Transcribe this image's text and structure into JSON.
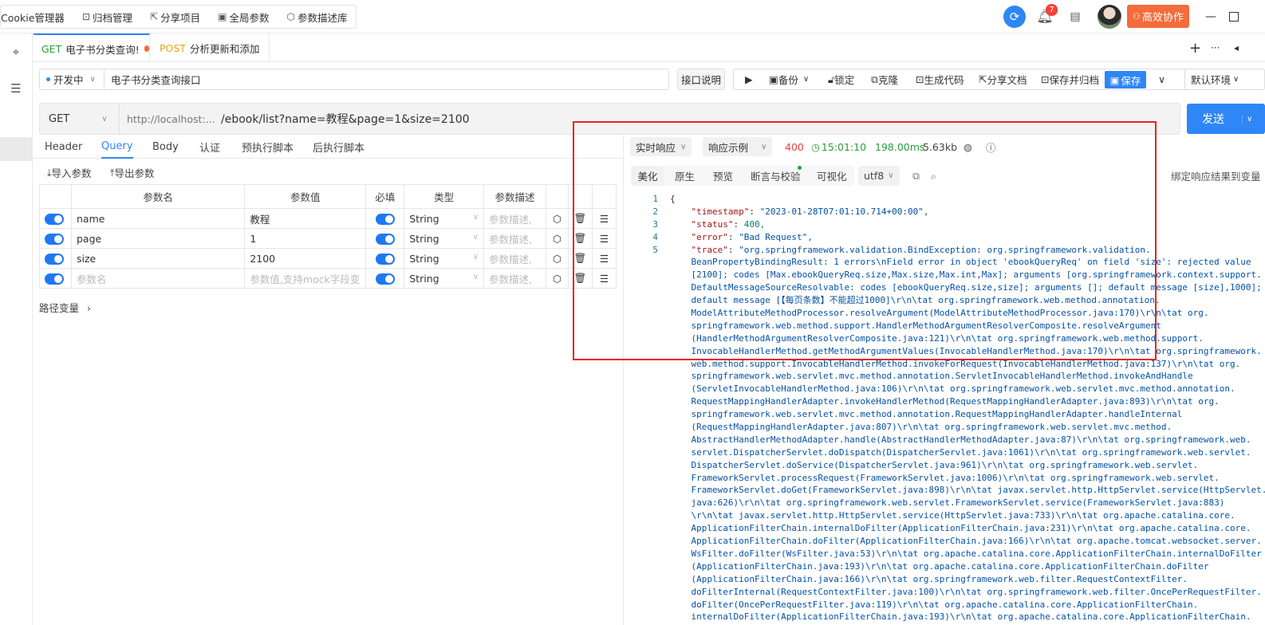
{
  "topnav": {
    "items": [
      {
        "icon": "cookie-icon",
        "label": "Cookie管理器"
      },
      {
        "icon": "archive-icon",
        "label": "归档管理"
      },
      {
        "icon": "share-icon",
        "label": "分享项目"
      },
      {
        "icon": "params-icon",
        "label": "全局参数"
      },
      {
        "icon": "cube-icon",
        "label": "参数描述库"
      }
    ],
    "notifications_count": "7",
    "collab_label": "高效协作"
  },
  "tabs": [
    {
      "method": "GET",
      "label": "电子书分类查询!",
      "unsaved": true
    },
    {
      "method": "POST",
      "label": "分析更新和添加"
    }
  ],
  "tabs_actions": {
    "add": "+",
    "more": "···",
    "collapse": "◂"
  },
  "api": {
    "status": "开发中",
    "name": "电子书分类查询接口"
  },
  "toolbar": {
    "doc_button": "接口说明",
    "backup": "备份",
    "lock": "锁定",
    "clone": "克隆",
    "gen_code": "生成代码",
    "share_doc": "分享文档",
    "save_archive": "保存并归档",
    "save": "保存",
    "env": "默认环境"
  },
  "request": {
    "method": "GET",
    "host": "http://localhost:...",
    "path": "/ebook/list?name=教程&page=1&size=2100",
    "send_label": "发送"
  },
  "req_tabs": [
    "Header",
    "Query",
    "Body",
    "认证",
    "预执行脚本",
    "后执行脚本"
  ],
  "params": {
    "import_label": "导入参数",
    "export_label": "导出参数",
    "columns": [
      "参数名",
      "参数值",
      "必填",
      "类型",
      "参数描述"
    ],
    "rows": [
      {
        "name": "name",
        "value": "教程",
        "type": "String",
        "desc": "参数描述,"
      },
      {
        "name": "page",
        "value": "1",
        "type": "String",
        "desc": "参数描述,"
      },
      {
        "name": "size",
        "value": "2100",
        "type": "String",
        "desc": "参数描述,"
      },
      {
        "name": "参数名",
        "value": "参数值,支持mock字段变",
        "type": "String",
        "desc": "参数描述,",
        "placeholder": true
      }
    ],
    "path_vars": "路径变量"
  },
  "response": {
    "mode": "实时响应",
    "example": "响应示例",
    "status_code": "400",
    "time": "15:01:10",
    "duration": "198.00ms",
    "size": "5.63kb",
    "tabs": [
      "美化",
      "原生",
      "预览",
      "断言与校验",
      "可视化"
    ],
    "encoding": "utf8",
    "bind_label": "绑定响应结果到变量",
    "line_numbers": [
      "1",
      "2",
      "3",
      "4",
      "5"
    ],
    "lines": [
      "{",
      "    \"timestamp\": \"2023-01-28T07:01:10.714+00:00\",",
      "    \"status\": 400,",
      "    \"error\": \"Bad Request\",",
      "    \"trace\": \"org.springframework.validation.BindException: org.springframework.validation.",
      "    BeanPropertyBindingResult: 1 errors\\nField error in object 'ebookQueryReq' on field 'size': rejected value",
      "    [2100]; codes [Max.ebookQueryReq.size,Max.size,Max.int,Max]; arguments [org.springframework.context.support.",
      "    DefaultMessageSourceResolvable: codes [ebookQueryReq.size,size]; arguments []; default message [size],1000];",
      "    default message [【每页条数】不能超过1000]\\r\\n\\tat org.springframework.web.method.annotation.",
      "    ModelAttributeMethodProcessor.resolveArgument(ModelAttributeMethodProcessor.java:170)\\r\\n\\tat org.",
      "    springframework.web.method.support.HandlerMethodArgumentResolverComposite.resolveArgument",
      "    (HandlerMethodArgumentResolverComposite.java:121)\\r\\n\\tat org.springframework.web.method.support.",
      "    InvocableHandlerMethod.getMethodArgumentValues(InvocableHandlerMethod.java:170)\\r\\n\\tat org.springframework.",
      "    web.method.support.InvocableHandlerMethod.invokeForRequest(InvocableHandlerMethod.java:137)\\r\\n\\tat org.",
      "    springframework.web.servlet.mvc.method.annotation.ServletInvocableHandlerMethod.invokeAndHandle",
      "    (ServletInvocableHandlerMethod.java:106)\\r\\n\\tat org.springframework.web.servlet.mvc.method.annotation.",
      "    RequestMappingHandlerAdapter.invokeHandlerMethod(RequestMappingHandlerAdapter.java:893)\\r\\n\\tat org.",
      "    springframework.web.servlet.mvc.method.annotation.RequestMappingHandlerAdapter.handleInternal",
      "    (RequestMappingHandlerAdapter.java:807)\\r\\n\\tat org.springframework.web.servlet.mvc.method.",
      "    AbstractHandlerMethodAdapter.handle(AbstractHandlerMethodAdapter.java:87)\\r\\n\\tat org.springframework.web.",
      "    servlet.DispatcherServlet.doDispatch(DispatcherServlet.java:1061)\\r\\n\\tat org.springframework.web.servlet.",
      "    DispatcherServlet.doService(DispatcherServlet.java:961)\\r\\n\\tat org.springframework.web.servlet.",
      "    FrameworkServlet.processRequest(FrameworkServlet.java:1006)\\r\\n\\tat org.springframework.web.servlet.",
      "    FrameworkServlet.doGet(FrameworkServlet.java:898)\\r\\n\\tat javax.servlet.http.HttpServlet.service(HttpServlet.",
      "    java:626)\\r\\n\\tat org.springframework.web.servlet.FrameworkServlet.service(FrameworkServlet.java:883)",
      "    \\r\\n\\tat javax.servlet.http.HttpServlet.service(HttpServlet.java:733)\\r\\n\\tat org.apache.catalina.core.",
      "    ApplicationFilterChain.internalDoFilter(ApplicationFilterChain.java:231)\\r\\n\\tat org.apache.catalina.core.",
      "    ApplicationFilterChain.doFilter(ApplicationFilterChain.java:166)\\r\\n\\tat org.apache.tomcat.websocket.server.",
      "    WsFilter.doFilter(WsFilter.java:53)\\r\\n\\tat org.apache.catalina.core.ApplicationFilterChain.internalDoFilter",
      "    (ApplicationFilterChain.java:193)\\r\\n\\tat org.apache.catalina.core.ApplicationFilterChain.doFilter",
      "    (ApplicationFilterChain.java:166)\\r\\n\\tat org.springframework.web.filter.RequestContextFilter.",
      "    doFilterInternal(RequestContextFilter.java:100)\\r\\n\\tat org.springframework.web.filter.OncePerRequestFilter.",
      "    doFilter(OncePerRequestFilter.java:119)\\r\\n\\tat org.apache.catalina.core.ApplicationFilterChain.",
      "    internalDoFilter(ApplicationFilterChain.java:193)\\r\\n\\tat org.apache.catalina.core.ApplicationFilterChain."
    ]
  },
  "colors": {
    "accent": "#2f86f6",
    "collab": "#f36c3b",
    "status_error": "#f5403b",
    "get": "#2a9d3a",
    "post": "#e9a121",
    "annotation_box": "#e8251f"
  }
}
